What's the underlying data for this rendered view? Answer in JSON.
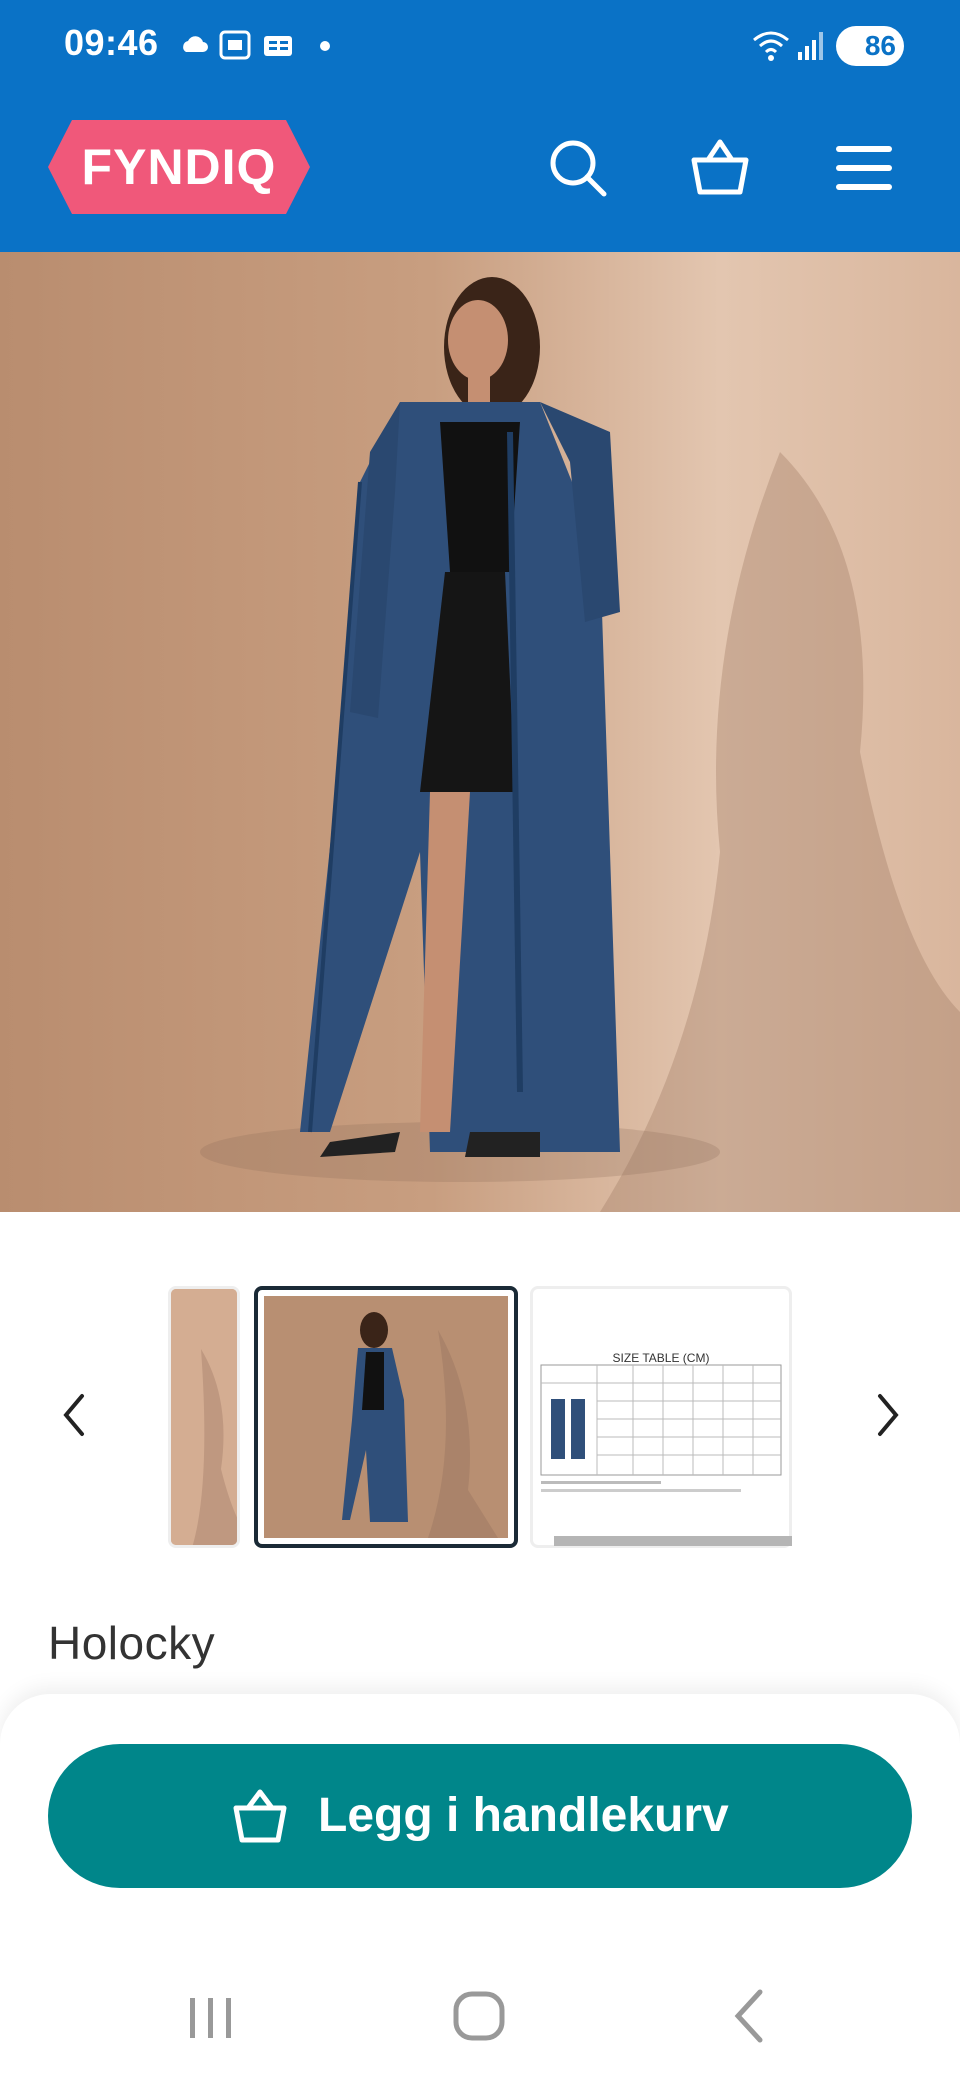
{
  "status_bar": {
    "time": "09:46",
    "battery": "86",
    "icons": [
      "cloud-icon",
      "screenshot-icon",
      "ge-icon",
      "dot-icon",
      "wifi-icon",
      "signal-icon"
    ]
  },
  "header": {
    "logo_text": "FYNDIQ",
    "brand_color": "#0a72c6",
    "logo_color": "#f0587a",
    "icons": [
      "search-icon",
      "basket-icon",
      "menu-icon"
    ]
  },
  "product": {
    "title": "Holocky",
    "image_alt": "Long denim coat"
  },
  "thumbnails": {
    "size_table_title": "SIZE TABLE (CM)",
    "selected_index": 1,
    "count": 3
  },
  "cart": {
    "button_label": "Legg i handlekurv",
    "button_color": "#00868a"
  },
  "nav_icons": [
    "recents-icon",
    "home-icon",
    "back-icon"
  ]
}
